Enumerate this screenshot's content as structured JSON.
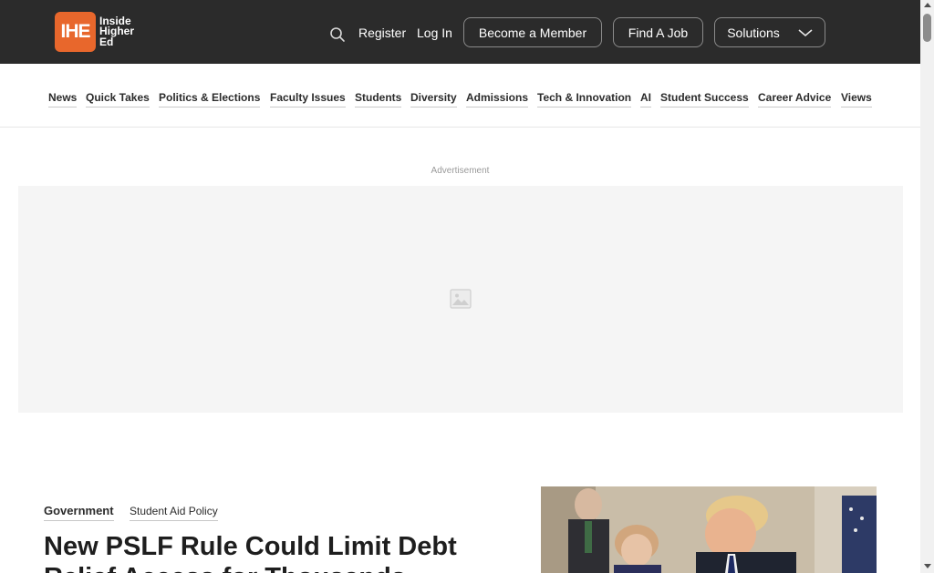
{
  "header": {
    "logo_mark": "IHE",
    "logo_lines": [
      "Inside",
      "Higher",
      "Ed"
    ],
    "register": "Register",
    "login": "Log In",
    "become_member": "Become a Member",
    "find_job": "Find A Job",
    "solutions": "Solutions",
    "icons": {
      "search": "search-icon",
      "solutions_toggle": "chevron-down-icon"
    }
  },
  "nav": {
    "items": [
      "News",
      "Quick Takes",
      "Politics & Elections",
      "Faculty Issues",
      "Students",
      "Diversity",
      "Admissions",
      "Tech & Innovation",
      "AI",
      "Student Success",
      "Career Advice",
      "Views"
    ]
  },
  "ad": {
    "label": "Advertisement",
    "placeholder_icon": "image-placeholder-icon"
  },
  "article": {
    "category": "Government",
    "subcategory": "Student Aid Policy",
    "headline": "New PSLF Rule Could Limit Debt Relief Access for Thousands"
  },
  "colors": {
    "topbar": "#2b2b2b",
    "brand_orange": "#e8672c",
    "text_dark": "#2b2b2b"
  }
}
